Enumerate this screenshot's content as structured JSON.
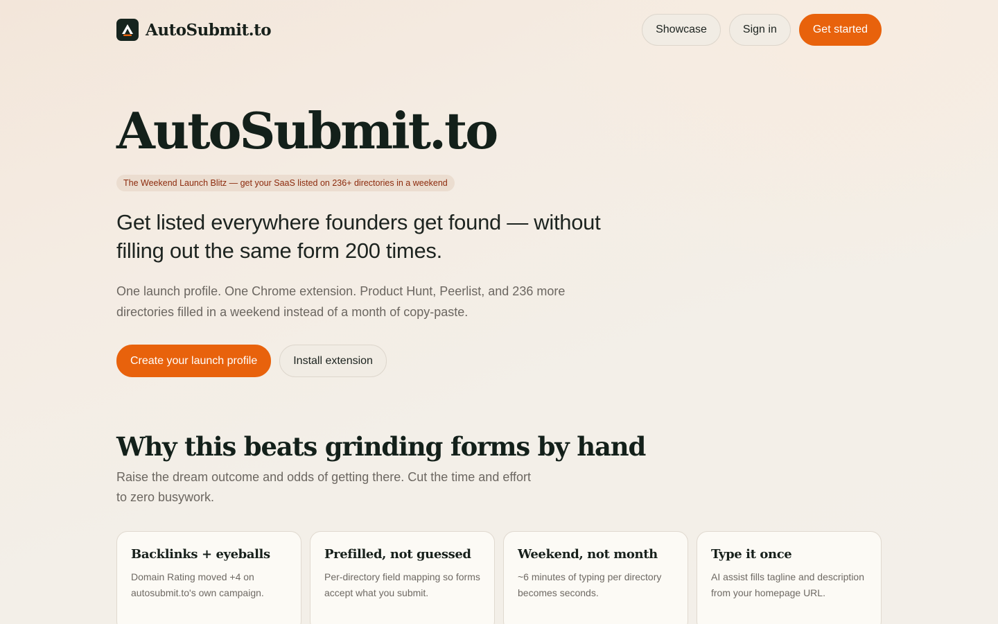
{
  "header": {
    "brand": "AutoSubmit.to",
    "nav": {
      "showcase": "Showcase",
      "sign_in": "Sign in",
      "get_started": "Get started"
    }
  },
  "hero": {
    "title": "AutoSubmit.to",
    "badge": "The Weekend Launch Blitz — get your SaaS listed on 236+ directories in a weekend",
    "lede": "Get listed everywhere founders get found — without filling out the same form 200 times.",
    "sub": "One launch profile. One Chrome extension. Product Hunt, Peerlist, and 236 more directories filled in a weekend instead of a month of copy-paste.",
    "cta_primary": "Create your launch profile",
    "cta_secondary": "Install extension"
  },
  "why": {
    "title": "Why this beats grinding forms by hand",
    "sub": "Raise the dream outcome and odds of getting there. Cut the time and effort to zero busywork.",
    "cards": [
      {
        "title": "Backlinks + eyeballs",
        "text": "Domain Rating moved +4 on autosubmit.to's own campaign."
      },
      {
        "title": "Prefilled, not guessed",
        "text": "Per-directory field mapping so forms accept what you submit."
      },
      {
        "title": "Weekend, not month",
        "text": "~6 minutes of typing per directory becomes seconds."
      },
      {
        "title": "Type it once",
        "text": "AI assist fills tagline and description from your homepage URL."
      }
    ]
  },
  "colors": {
    "accent": "#e8620c",
    "ink": "#13201a",
    "muted": "#6b6660",
    "badge_bg": "#ebddd0",
    "badge_text": "#8c2a0c"
  },
  "icons": {
    "logo": "autosubmit-logo-icon"
  }
}
